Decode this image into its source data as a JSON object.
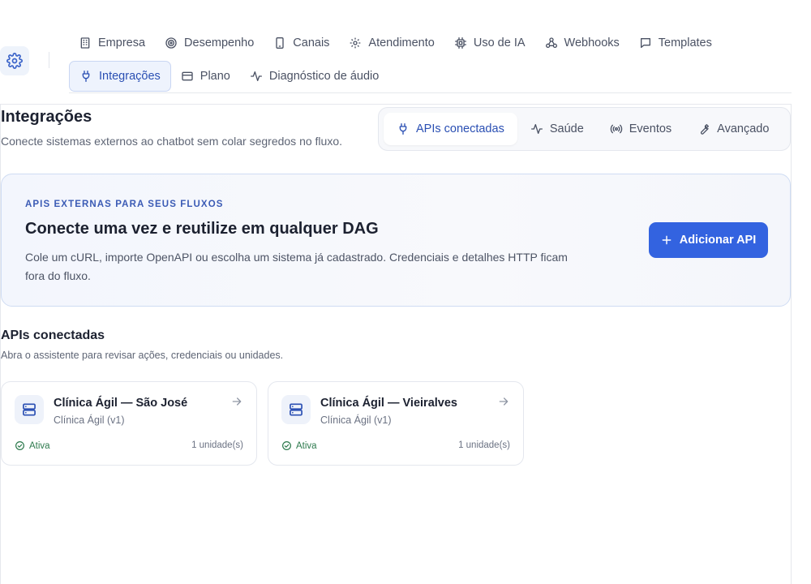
{
  "nav": {
    "row1": [
      {
        "label": "Empresa",
        "icon": "building-icon"
      },
      {
        "label": "Desempenho",
        "icon": "target-icon"
      },
      {
        "label": "Canais",
        "icon": "phone-icon"
      },
      {
        "label": "Atendimento",
        "icon": "gear-icon"
      },
      {
        "label": "Uso de IA",
        "icon": "chip-icon"
      },
      {
        "label": "Webhooks",
        "icon": "webhook-icon"
      },
      {
        "label": "Templates",
        "icon": "message-icon"
      }
    ],
    "row2": [
      {
        "label": "Integrações",
        "icon": "plug-icon",
        "active": true
      },
      {
        "label": "Plano",
        "icon": "card-icon"
      },
      {
        "label": "Diagnóstico de áudio",
        "icon": "pulse-icon"
      }
    ]
  },
  "page": {
    "title": "Integrações",
    "subtitle": "Conecte sistemas externos ao chatbot sem colar segredos no fluxo."
  },
  "tabs": [
    {
      "label": "APIs conectadas",
      "icon": "plug-icon",
      "active": true
    },
    {
      "label": "Saúde",
      "icon": "pulse-icon"
    },
    {
      "label": "Eventos",
      "icon": "broadcast-icon"
    },
    {
      "label": "Avançado",
      "icon": "wrench-icon"
    }
  ],
  "hero": {
    "eyebrow": "APIS EXTERNAS PARA SEUS FLUXOS",
    "title": "Conecte uma vez e reutilize em qualquer DAG",
    "description": "Cole um cURL, importe OpenAPI ou escolha um sistema já cadastrado. Credenciais e detalhes HTTP ficam fora do fluxo.",
    "button_label": "Adicionar API"
  },
  "section": {
    "title": "APIs conectadas",
    "subtitle": "Abra o assistente para revisar ações, credenciais ou unidades."
  },
  "apis": [
    {
      "name": "Clínica Ágil — São José",
      "meta": "Clínica Ágil (v1)",
      "status": "Ativa",
      "units": "1 unidade(s)"
    },
    {
      "name": "Clínica Ágil — Vieiralves",
      "meta": "Clínica Ágil (v1)",
      "status": "Ativa",
      "units": "1 unidade(s)"
    }
  ],
  "colors": {
    "accent": "#3363e0",
    "active_text": "#2a4fb3",
    "status_green": "#2d7a4d"
  }
}
